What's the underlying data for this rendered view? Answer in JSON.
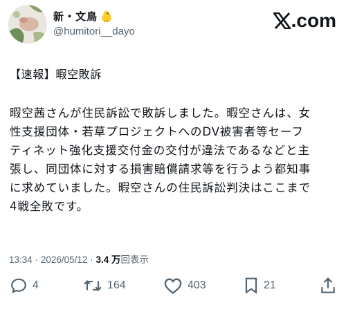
{
  "author": {
    "display_name": "新・文鳥",
    "handle": "@humitori__dayo",
    "avatar_icon": "avatar-icon",
    "badge_icon": "chick-emoji-icon"
  },
  "brand": {
    "label": ".com",
    "logo_icon": "x-logo-icon"
  },
  "post": {
    "headline": "【速報】暇空敗訴",
    "body": "暇空茜さんが住民訴訟で敗訴しました。暇空さんは、女\n性支援団体・若草プロジェクトへのDV被害者等セーフ\nティネット強化支援交付金の交付が違法であるなどと主\n張し、同団体に対する損害賠償請求等を行うよう都知事\nに求めていました。暇空さんの住民訴訟判決はここまで\n4戦全敗です。"
  },
  "meta": {
    "time": "13:34",
    "separator": "·",
    "date": "2026/05/12",
    "views_count": "3.4 万",
    "views_label": "回表示"
  },
  "actions": {
    "replies": "4",
    "reposts": "164",
    "likes": "403",
    "bookmarks": "21"
  },
  "colors": {
    "text": "#0f1419",
    "muted": "#536471",
    "background": "#ffffff"
  }
}
